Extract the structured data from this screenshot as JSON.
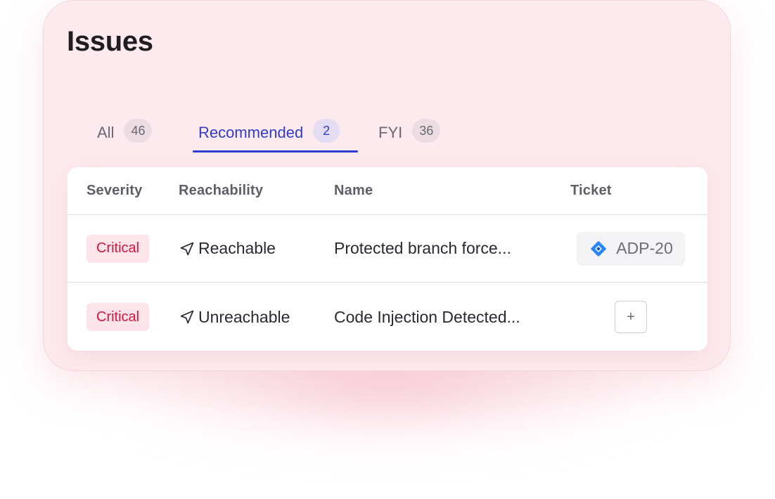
{
  "header": {
    "title": "Issues"
  },
  "tabs": [
    {
      "label": "All",
      "count": "46"
    },
    {
      "label": "Recommended",
      "count": "2",
      "active": true
    },
    {
      "label": "FYI",
      "count": "36"
    }
  ],
  "table": {
    "columns": [
      "Severity",
      "Reachability",
      "Name",
      "Ticket"
    ],
    "rows": [
      {
        "severity": "Critical",
        "reachability": "Reachable",
        "reachability_icon": "navigation-arrow-icon",
        "name": "Protected branch force...",
        "ticket": "ADP-20",
        "ticket_icon": "jira-icon"
      },
      {
        "severity": "Critical",
        "reachability": "Unreachable",
        "reachability_icon": "navigation-arrow-icon",
        "name": "Code Injection Detected...",
        "ticket_action": "+"
      }
    ]
  },
  "colors": {
    "accent": "#2f3ccf",
    "critical_text": "#dc143c",
    "critical_bg": "#fde4ea",
    "card_bg": "#fdeaee"
  }
}
